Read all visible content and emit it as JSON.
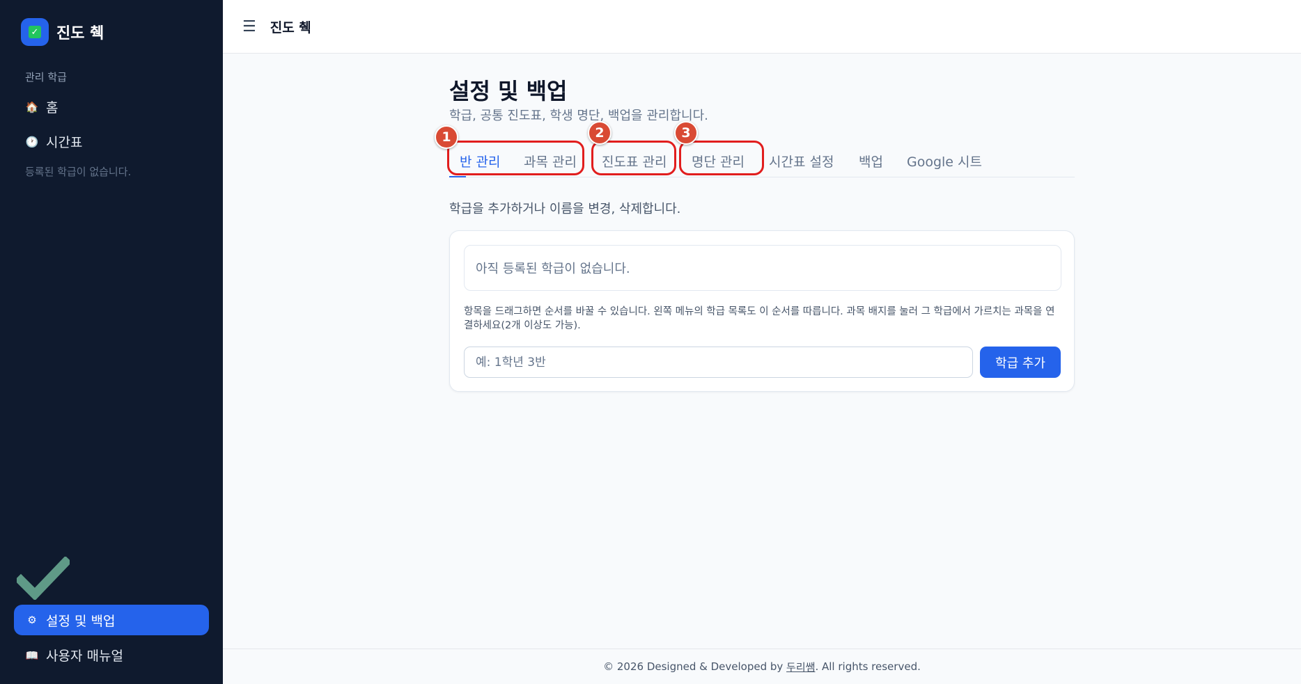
{
  "app": {
    "name": "진도 췍"
  },
  "sidebar": {
    "section_label": "관리 학급",
    "items": [
      {
        "label": "홈",
        "icon": "house-icon"
      },
      {
        "label": "시간표",
        "icon": "clock-icon"
      }
    ],
    "empty_text": "등록된 학급이 없습니다.",
    "bottom_items": [
      {
        "label": "설정 및 백업",
        "icon": "gear-icon",
        "active": true
      },
      {
        "label": "사용자 매뉴얼",
        "icon": "book-icon"
      }
    ]
  },
  "topbar": {
    "menu_icon": "☰",
    "title": "진도 췍"
  },
  "page": {
    "title": "설정 및 백업",
    "description": "학급, 공통 진도표, 학생 명단, 백업을 관리합니다."
  },
  "tabs": [
    {
      "label": "반 관리",
      "active": true
    },
    {
      "label": "과목 관리"
    },
    {
      "label": "진도표 관리"
    },
    {
      "label": "명단 관리"
    },
    {
      "label": "시간표 설정"
    },
    {
      "label": "백업"
    },
    {
      "label": "Google 시트"
    }
  ],
  "annotations": [
    "1",
    "2",
    "3"
  ],
  "class_management": {
    "description": "학급을 추가하거나 이름을 변경, 삭제합니다.",
    "empty_text": "아직 등록된 학급이 없습니다.",
    "hint": "항목을 드래그하면 순서를 바꿀 수 있습니다. 왼쪽 메뉴의 학급 목록도 이 순서를 따릅니다. 과목 배지를 눌러 그 학급에서 가르치는 과목을 연결하세요(2개 이상도 가능).",
    "input_placeholder": "예: 1학년 3반",
    "add_button": "학급 추가"
  },
  "footer": {
    "prefix": "© 2026 Designed & Developed by ",
    "author": "두리쌤",
    "suffix": ". All rights reserved."
  },
  "colors": {
    "sidebar_bg": "#0f1a2e",
    "accent": "#2563eb",
    "annotation_red": "#e11d1d",
    "badge_red": "#d94a34",
    "check_green": "#5f9a87"
  }
}
